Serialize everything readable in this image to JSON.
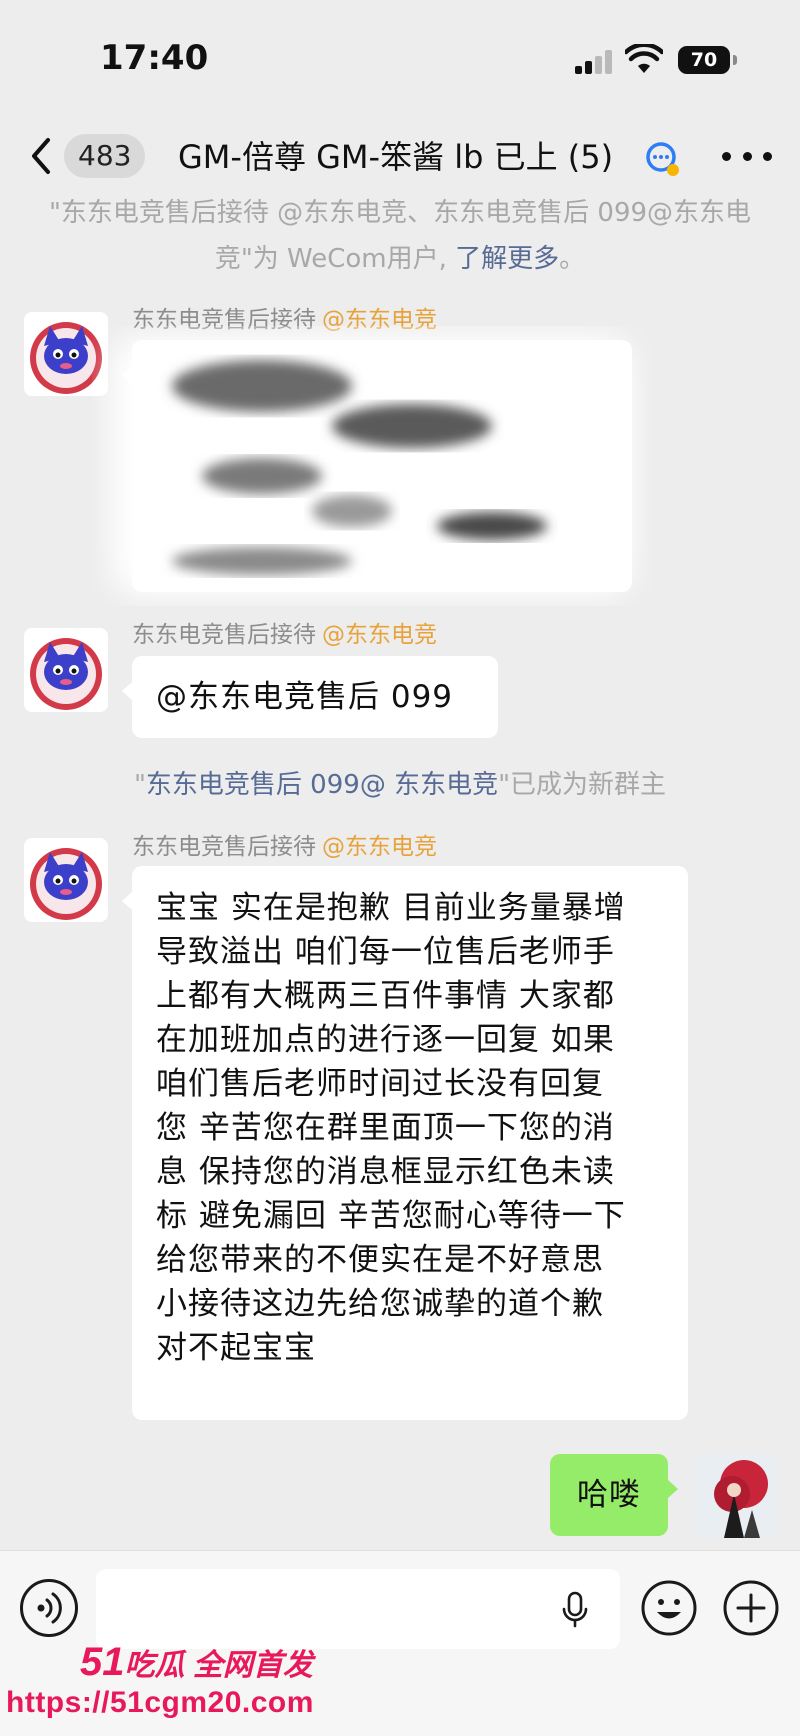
{
  "status_bar": {
    "time": "17:40",
    "battery": "70"
  },
  "nav": {
    "unread_count": "483",
    "title": "GM-倍尊 GM-笨酱  lb 已上 (5)"
  },
  "system_notices": {
    "wecom_prefix": "\"东东电竞售后接待 @东东电竞、东东电竞售后 099@东东电竞\"为 WeCom用户, ",
    "wecom_link": "了解更多",
    "wecom_suffix": "。",
    "owner_prefix": "\"",
    "owner_link": "东东电竞售后 099@ 东东电竞",
    "owner_suffix": "\"已成为新群主"
  },
  "messages": [
    {
      "sender": "东东电竞售后接待",
      "sender_tag": "@东东电竞",
      "type": "image",
      "content": ""
    },
    {
      "sender": "东东电竞售后接待",
      "sender_tag": "@东东电竞",
      "type": "text",
      "content": "@东东电竞售后 099"
    },
    {
      "sender": "东东电竞售后接待",
      "sender_tag": "@东东电竞",
      "type": "text",
      "content": "宝宝 实在是抱歉 目前业务量暴增\n导致溢出 咱们每一位售后老师手\n上都有大概两三百件事情 大家都\n在加班加点的进行逐一回复 如果\n咱们售后老师时间过长没有回复\n您 辛苦您在群里面顶一下您的消\n息 保持您的消息框显示红色未读\n标 避免漏回 辛苦您耐心等待一下\n给您带来的不便实在是不好意思\n小接待这边先给您诚挚的道个歉\n对不起宝宝"
    },
    {
      "sender": "self",
      "type": "text",
      "content": "哈喽"
    }
  ],
  "input_bar": {
    "placeholder": ""
  },
  "watermark": {
    "line1_num": "51",
    "line1_text": "吃瓜 全网首发",
    "line2": "https://51cgm20.com"
  },
  "colors": {
    "background": "#ededed",
    "outgoing_bubble": "#95ec69",
    "link": "#576b95",
    "sender_tag": "#e8a23a",
    "watermark": "#e8195a"
  },
  "icons": [
    "back-chevron-icon",
    "signal-icon",
    "wifi-icon",
    "battery-icon",
    "wecom-badge-icon",
    "more-icon",
    "voice-icon",
    "microphone-icon",
    "emoji-icon",
    "plus-icon",
    "cat-mascot-avatar",
    "user-avatar"
  ]
}
